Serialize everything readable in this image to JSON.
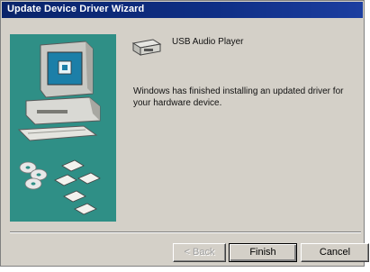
{
  "window": {
    "title": "Update Device Driver Wizard"
  },
  "device": {
    "name": "USB Audio Player",
    "icon": "audio-device-icon"
  },
  "message": "Windows has finished installing an updated driver for your hardware device.",
  "buttons": {
    "back": "< Back",
    "finish": "Finish",
    "cancel": "Cancel"
  },
  "colors": {
    "titlebar": "#0a246a",
    "illustration_bg": "#2f8f86",
    "dialog_bg": "#d4d0c8"
  }
}
